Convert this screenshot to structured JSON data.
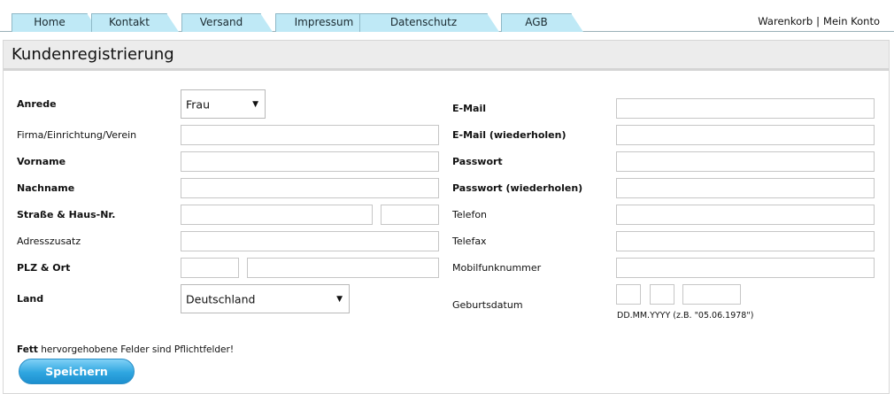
{
  "nav": {
    "tabs": [
      "Home",
      "Kontakt",
      "Versand",
      "Impressum",
      "Datenschutz",
      "AGB"
    ],
    "cart_label": "Warenkorb",
    "separator": "|",
    "account_label": "Mein Konto"
  },
  "page": {
    "title": "Kundenregistrierung"
  },
  "form": {
    "anrede_label": "Anrede",
    "anrede_value": "Frau",
    "firma_label": "Firma/Einrichtung/Verein",
    "vorname_label": "Vorname",
    "nachname_label": "Nachname",
    "strasse_label": "Straße & Haus-Nr.",
    "adresszusatz_label": "Adresszusatz",
    "plz_ort_label": "PLZ & Ort",
    "land_label": "Land",
    "land_value": "Deutschland",
    "email_label": "E-Mail",
    "email_repeat_label": "E-Mail (wiederholen)",
    "passwort_label": "Passwort",
    "passwort_repeat_label": "Passwort (wiederholen)",
    "telefon_label": "Telefon",
    "telefax_label": "Telefax",
    "mobil_label": "Mobilfunknummer",
    "geburtsdatum_label": "Geburtsdatum",
    "geburtsdatum_hint": "DD.MM.YYYY (z.B. \"05.06.1978\")",
    "note_bold": "Fett",
    "note_rest": " hervorgehobene Felder sind Pflichtfelder!",
    "save_label": "Speichern"
  }
}
